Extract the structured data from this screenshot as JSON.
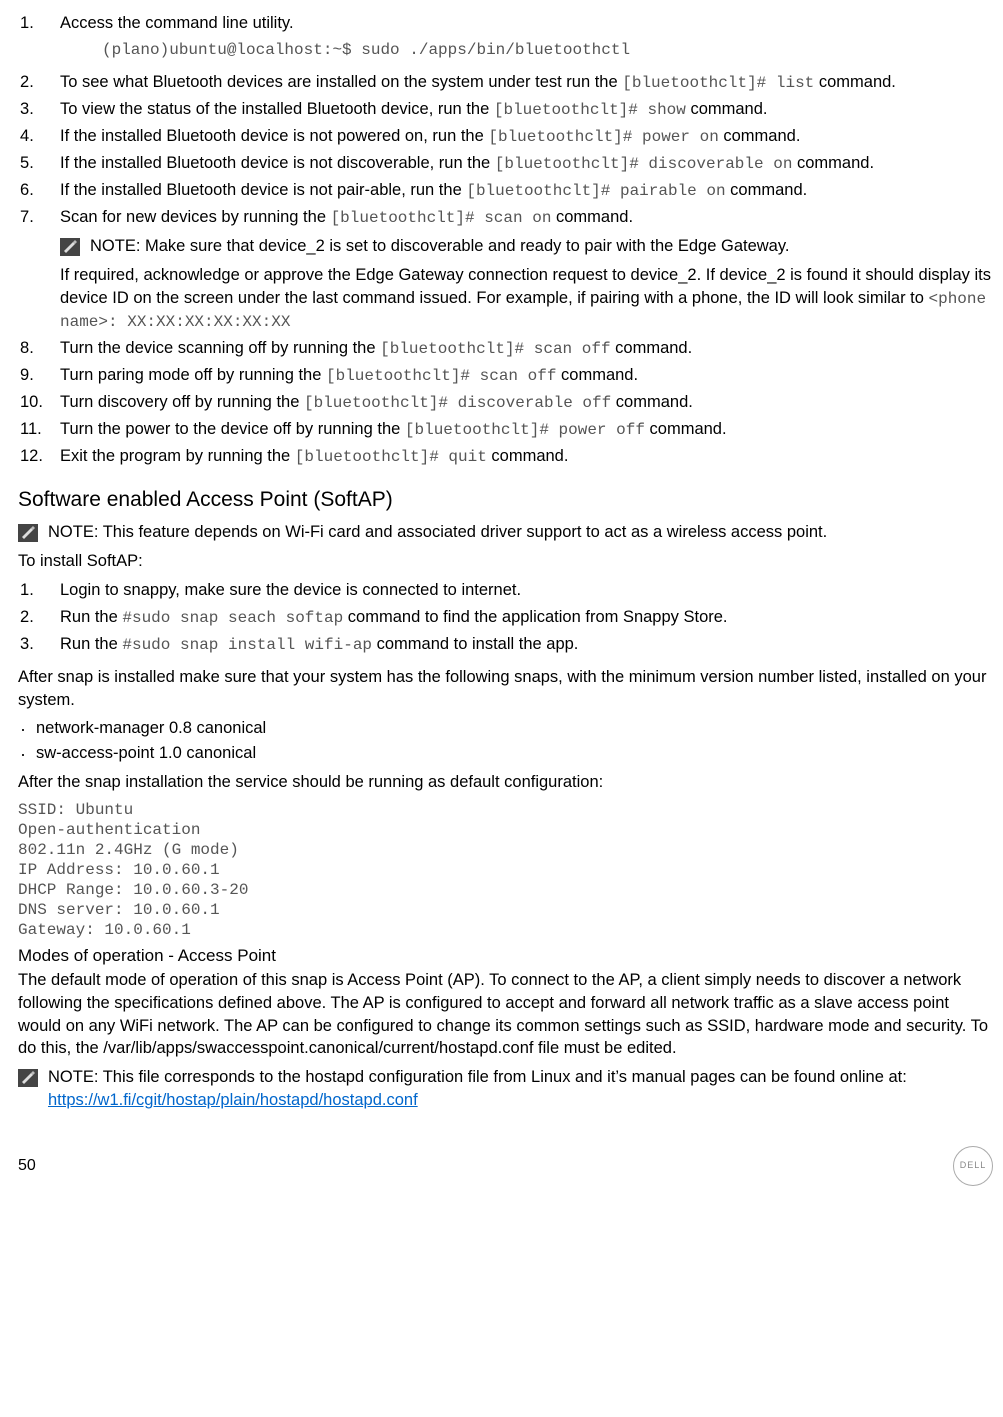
{
  "list1": {
    "items": [
      {
        "text_a": "Access the command line utility."
      },
      {
        "text_a": "To see what Bluetooth devices are installed on the system under test run the ",
        "code": "[bluetoothclt]# list",
        "text_b": " command."
      },
      {
        "text_a": "To view the status of the installed Bluetooth device, run the ",
        "code": "[bluetoothclt]# show",
        "text_b": " command."
      },
      {
        "text_a": "If the installed Bluetooth device is not powered on, run the ",
        "code": "[bluetoothclt]# power on",
        "text_b": " command."
      },
      {
        "text_a": "If the installed Bluetooth device is not discoverable, run the ",
        "code": "[bluetoothclt]# discoverable on",
        "text_b": " command."
      },
      {
        "text_a": "If the installed Bluetooth device is not pair-able, run the ",
        "code": "[bluetoothclt]# pairable on",
        "text_b": " command."
      },
      {
        "text_a": "Scan for new devices by running the ",
        "code": "[bluetoothclt]# scan on",
        "text_b": " command."
      },
      {
        "text_a": "Turn the device scanning off by running the ",
        "code": "[bluetoothclt]# scan off",
        "text_b": " command."
      },
      {
        "text_a": "Turn paring mode off by running the ",
        "code": "[bluetoothclt]# scan off",
        "text_b": " command."
      },
      {
        "text_a": "Turn discovery off by running the ",
        "code": "[bluetoothclt]# discoverable off",
        "text_b": " command."
      },
      {
        "text_a": "Turn the power to the device off by running the ",
        "code": "[bluetoothclt]# power off",
        "text_b": " command."
      },
      {
        "text_a": "Exit the program by running the ",
        "code": "[bluetoothclt]# quit",
        "text_b": " command."
      }
    ],
    "cmdline1": "(plano)ubuntu@localhost:~$ sudo ./apps/bin/bluetoothctl",
    "note7": "NOTE: Make sure that device_2 is set to discoverable and ready to pair with the Edge Gateway.",
    "sub7_a": "If required, acknowledge or approve the Edge Gateway connection request to device_2. If device_2 is found it should display its device ID on the screen under the last command issued. For example, if pairing with a phone, the ID will look similar to ",
    "sub7_code": "<phone name>: XX:XX:XX:XX:XX:XX"
  },
  "softap": {
    "heading": "Software enabled Access Point (SoftAP)",
    "note": "NOTE: This feature depends on Wi-Fi card and associated driver support to act as a wireless access point.",
    "intro": "To install SoftAP:",
    "steps": [
      {
        "text_a": "Login to snappy, make sure the device is connected to internet."
      },
      {
        "text_a": "Run the ",
        "code": "#sudo snap seach softap",
        "text_b": " command to find the application from Snappy Store."
      },
      {
        "text_a": "Run the ",
        "code": "#sudo snap install wifi-ap",
        "text_b": " command to install the app."
      }
    ],
    "after1": "After snap is installed make sure that your system has the following snaps, with the minimum version number listed, installed on your system.",
    "bullets": [
      "network-manager 0.8 canonical",
      "sw-access-point 1.0 canonical"
    ],
    "after2": "After the snap installation the service should be running as default configuration:",
    "config": "SSID: Ubuntu\nOpen-authentication\n802.11n 2.4GHz (G mode)\nIP Address: 10.0.60.1\nDHCP Range: 10.0.60.3-20\nDNS server: 10.0.60.1\nGateway: 10.0.60.1"
  },
  "modes": {
    "heading": "Modes of operation - Access Point",
    "para": "The default mode of operation of this snap is Access Point (AP). To connect to the AP, a client simply needs to discover a network following the specifications defined above. The AP is configured to accept and forward all network traffic as a slave access point would on any WiFi network. The AP can be configured to change its common settings such as SSID, hardware mode and security. To do this, the /var/lib/apps/swaccesspoint.canonical/current/hostapd.conf file must be edited.",
    "note_a": "NOTE: This file corresponds to the hostapd configuration file from Linux and it’s manual pages can be found online at: ",
    "note_link_text": "https://w1.fi/cgit/hostap/plain/hostapd/hostapd.conf",
    "note_link_href": "https://w1.fi/cgit/hostap/plain/hostapd/hostapd.conf"
  },
  "footer": {
    "page": "50",
    "logo": "DELL"
  }
}
